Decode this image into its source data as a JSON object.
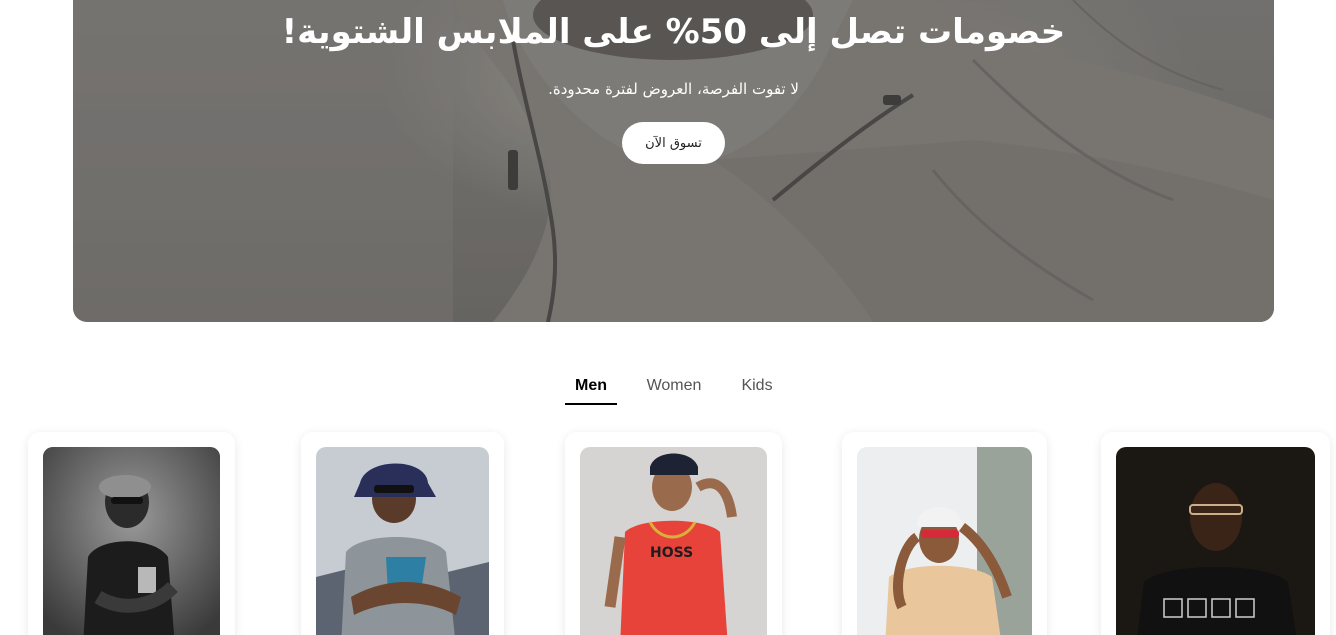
{
  "hero": {
    "title": "خصومات تصل إلى 50% على الملابس الشتوية!",
    "subtitle": "لا تفوت الفرصة، العروض لفترة محدودة.",
    "cta_label": "تسوق الآن"
  },
  "tabs": [
    {
      "label": "Men",
      "active": true
    },
    {
      "label": "Women",
      "active": false
    },
    {
      "label": "Kids",
      "active": false
    }
  ],
  "products": [
    {
      "photo": "man-grayscale-cap-portrait"
    },
    {
      "photo": "man-bucket-hat-sunglasses-arms-crossed"
    },
    {
      "photo": "man-red-tshirt-cap"
    },
    {
      "photo": "man-beige-tshirt-red-sunglasses"
    },
    {
      "photo": "man-black-tshirt-glasses"
    }
  ],
  "colors": {
    "accent": "#000000",
    "hero_overlay": "#7a7875",
    "cta_background": "#ffffff"
  }
}
